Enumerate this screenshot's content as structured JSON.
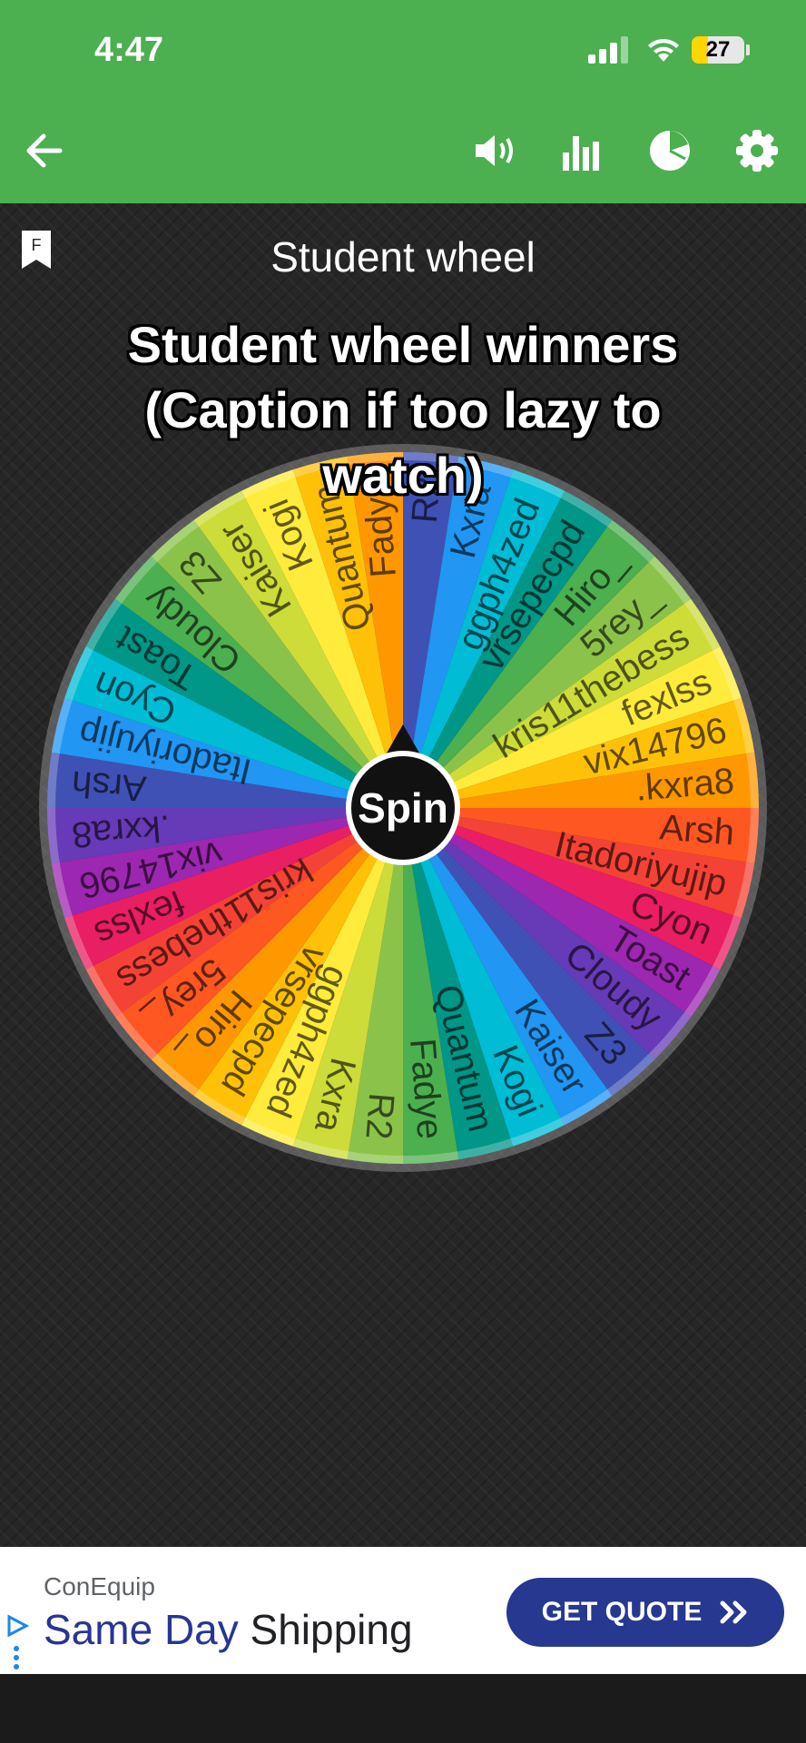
{
  "status_bar": {
    "time": "4:47",
    "battery": "27"
  },
  "toolbar": {
    "back_icon": "arrow-left-icon",
    "icons": [
      "volume-icon",
      "bar-chart-icon",
      "pie-chart-icon",
      "settings-icon"
    ]
  },
  "wheel": {
    "bookmark_letter": "F",
    "title": "Student wheel",
    "caption": "Student wheel winners (Caption if too lazy to watch)",
    "spin_label": "Spin",
    "entries": [
      "R2",
      "Kxra",
      "ggph4zed",
      "vrsepecpd",
      "Hiro_",
      "5rey_",
      "kris11thebess",
      "fexlss",
      "vix14796",
      ".kxra8",
      "Arsh",
      "Itadoriyujip",
      "Cyon",
      "Toast",
      "Cloudy",
      "Z3",
      "Kaiser",
      "Kogi",
      "Quantum",
      "Fadye",
      "R2",
      "Kxra",
      "ggph4zed",
      "vrsepecpd",
      "Hiro_",
      "5rey_",
      "kris11thebess",
      "fexlss",
      "vix14796",
      ".kxra8",
      "Arsh",
      "Itadoriyujip",
      "Cyon",
      "Toast",
      "Cloudy",
      "Z3",
      "Kaiser",
      "Kogi",
      "Quantum",
      "Fadye"
    ],
    "colors": [
      "#3f51b5",
      "#2196f3",
      "#00bcd4",
      "#009688",
      "#4caf50",
      "#8bc34a",
      "#cddc39",
      "#ffeb3b",
      "#ffc107",
      "#ff9800",
      "#ff5722",
      "#f44336",
      "#e91e63",
      "#9c27b0",
      "#673ab7"
    ]
  },
  "ad": {
    "brand": "ConEquip",
    "headline_highlight": "Same Day",
    "headline_rest": " Shipping",
    "cta": "GET QUOTE",
    "cta_icon": "double-chevron-right-icon"
  }
}
